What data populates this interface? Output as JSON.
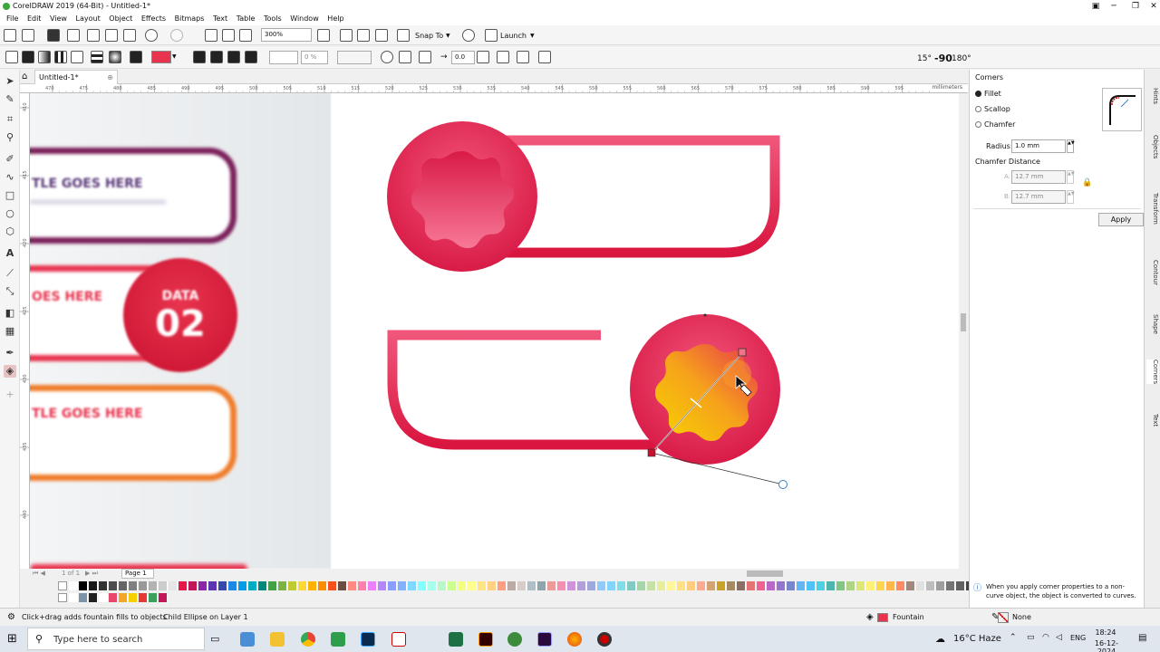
{
  "window": {
    "title": "CorelDRAW 2019 (64-Bit) - Untitled-1*"
  },
  "menu": [
    "File",
    "Edit",
    "View",
    "Layout",
    "Object",
    "Effects",
    "Bitmaps",
    "Text",
    "Table",
    "Tools",
    "Window",
    "Help"
  ],
  "toolbar": {
    "zoom": "300%",
    "snap_label": "Snap To",
    "launch_label": "Launch"
  },
  "propbar": {
    "transparency": "0 %",
    "offset": "0.0",
    "angles": [
      "15°",
      "-90",
      "180°"
    ]
  },
  "doc": {
    "tab": "Untitled-1*",
    "ruler_unit": "millimeters",
    "ruler_ticks": [
      "470",
      "475",
      "480",
      "485",
      "490",
      "495",
      "500",
      "505",
      "510",
      "515",
      "520",
      "525",
      "530",
      "535",
      "540",
      "545",
      "550",
      "555",
      "560",
      "565",
      "570",
      "575",
      "580",
      "585",
      "590",
      "595"
    ],
    "vruler_ticks": [
      "410",
      "415",
      "420",
      "425",
      "430",
      "435",
      "440"
    ]
  },
  "artwork": {
    "left_labels": [
      "TLE GOES HERE",
      "OES HERE",
      "TLE GOES HERE"
    ],
    "badge_top": "DATA",
    "badge_num": "02"
  },
  "pages": {
    "counter": "1 of 1",
    "tab": "Page 1"
  },
  "docker": {
    "title": "Corners",
    "options": [
      "Fillet",
      "Scallop",
      "Chamfer"
    ],
    "selected": "Fillet",
    "radius_label": "Radius:",
    "radius_value": "1.0 mm",
    "chamfer_label": "Chamfer Distance",
    "a_label": "A:",
    "a_value": "12.7 mm",
    "b_label": "B:",
    "b_value": "12.7 mm",
    "apply_label": "Apply",
    "info": "When you apply corner properties to a non-curve object, the object is converted to curves."
  },
  "docker_tabs": [
    "Hints",
    "Objects",
    "Transform",
    "Contour",
    "Shape",
    "Corners",
    "Text"
  ],
  "status": {
    "hint": "Click+drag adds fountain fills to objects",
    "object": "Child Ellipse on Layer 1",
    "fill": "Fountain",
    "outline": "None"
  },
  "taskbar": {
    "search": "Type here to search",
    "weather": "16°C  Haze",
    "lang": "ENG",
    "time": "18:24",
    "date": "16-12-2024"
  },
  "palette": {
    "row1": [
      "#ffffff",
      "#000000",
      "#1a1a1a",
      "#333333",
      "#4d4d4d",
      "#666666",
      "#808080",
      "#999999",
      "#b3b3b3",
      "#cccccc",
      "#e6e6e6",
      "#e6194b",
      "#c2185b",
      "#8e24aa",
      "#5e35b1",
      "#3949ab",
      "#1e88e5",
      "#039be5",
      "#00acc1",
      "#00897b",
      "#43a047",
      "#7cb342",
      "#c0ca33",
      "#fdd835",
      "#ffb300",
      "#fb8c00",
      "#f4511e",
      "#6d4c41",
      "#ff8a80",
      "#ff80ab",
      "#ea80fc",
      "#b388ff",
      "#8c9eff",
      "#82b1ff",
      "#80d8ff",
      "#84ffff",
      "#a7ffeb",
      "#b9f6ca",
      "#ccff90",
      "#f4ff81",
      "#ffff8d",
      "#ffe57f",
      "#ffd180",
      "#ff9e80",
      "#bcaaa4",
      "#d7ccc8",
      "#b0bec5",
      "#90a4ae",
      "#ef9a9a",
      "#f48fb1",
      "#ce93d8",
      "#b39ddb",
      "#9fa8da",
      "#90caf9",
      "#81d4fa",
      "#80deea",
      "#80cbc4",
      "#a5d6a7",
      "#c5e1a5",
      "#e6ee9c",
      "#fff59d",
      "#ffe082",
      "#ffcc80",
      "#ffab91",
      "#d4a373",
      "#c9a227",
      "#a68a64",
      "#8d6e63",
      "#e57373",
      "#f06292",
      "#ba68c8",
      "#9575cd",
      "#7986cb",
      "#64b5f6",
      "#4fc3f7",
      "#4dd0e1",
      "#4db6ac",
      "#81c784",
      "#aed581",
      "#dce775",
      "#fff176",
      "#ffd54f",
      "#ffb74d",
      "#ff8a65",
      "#a1887f",
      "#e0e0e0",
      "#bdbdbd",
      "#9e9e9e",
      "#757575",
      "#616161",
      "#424242",
      "#212121"
    ],
    "row2": [
      "#ffffff",
      "#7c93a8",
      "#222222",
      "#ffffff",
      "#e8476b",
      "#f5a623",
      "#f7d000",
      "#e53935",
      "#3aa05a",
      "#c2185b"
    ]
  }
}
